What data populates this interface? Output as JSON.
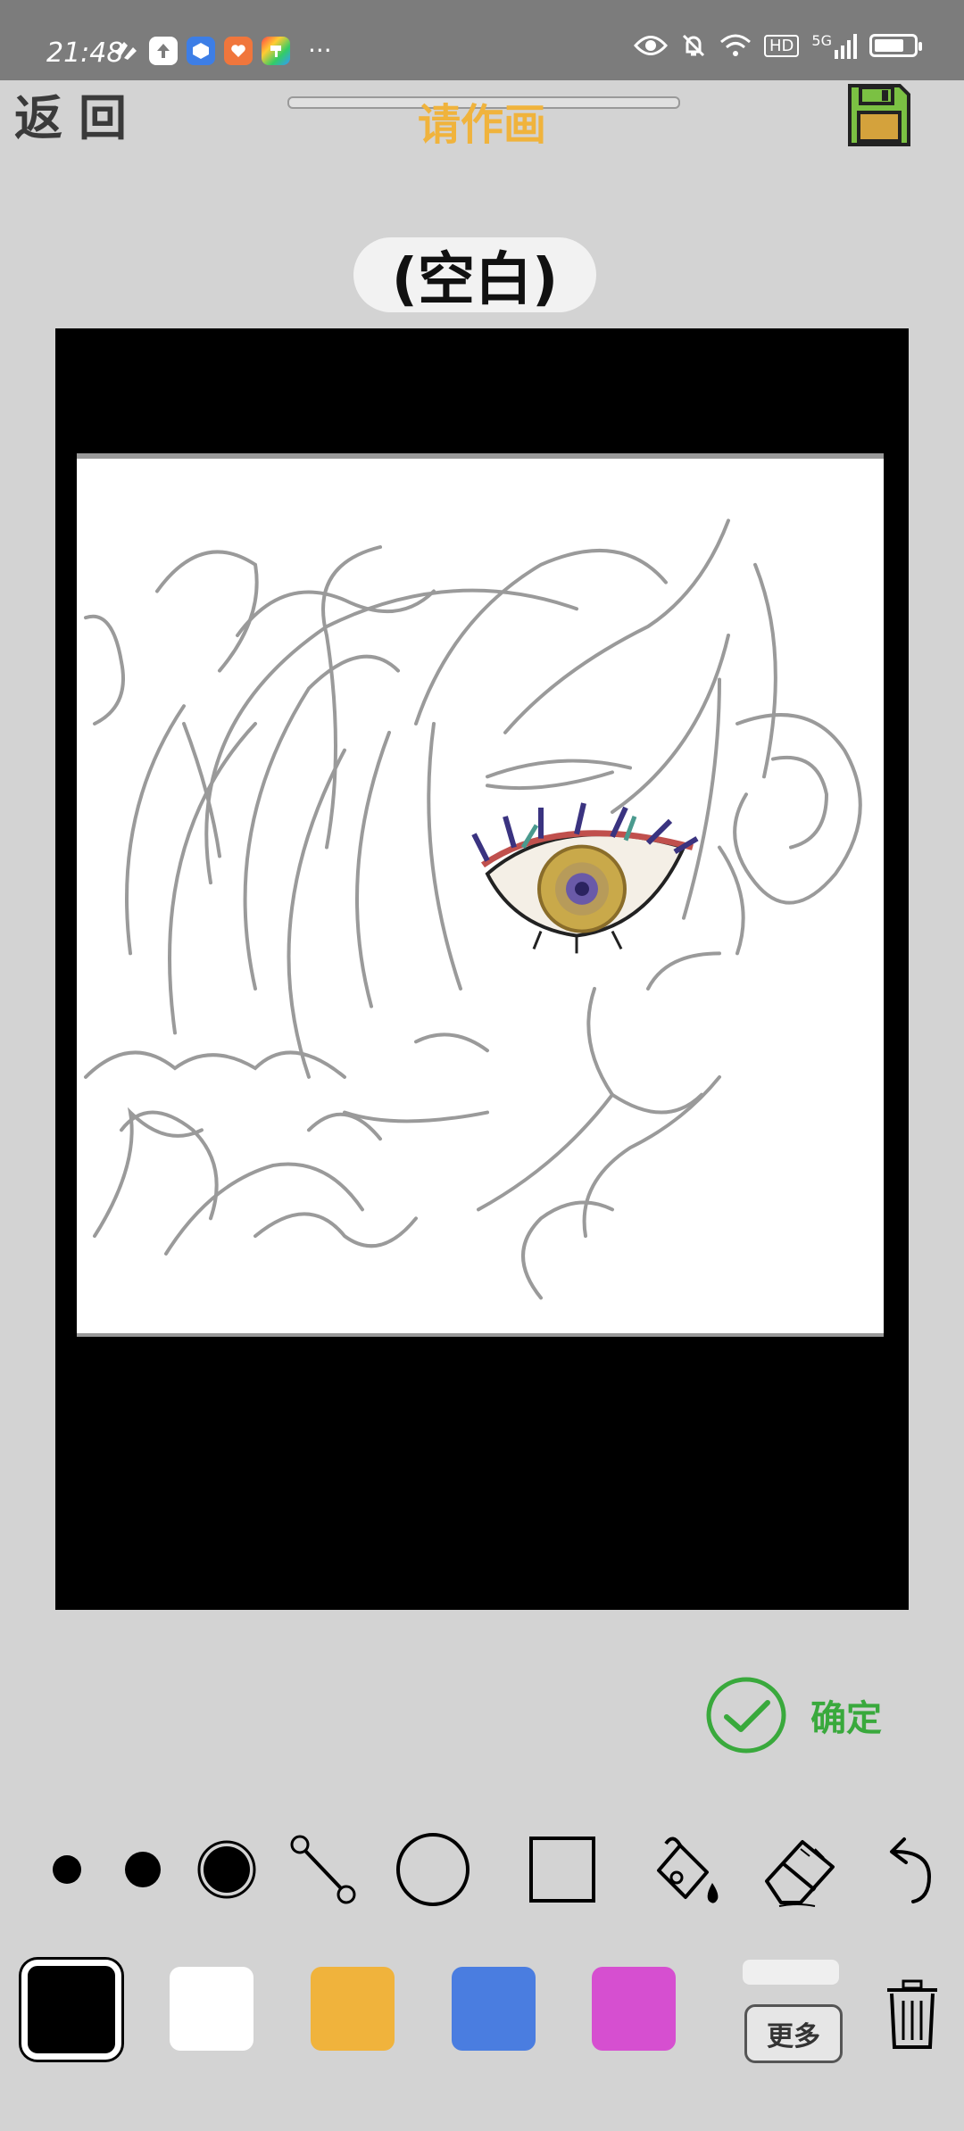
{
  "status_bar": {
    "time": "21:48",
    "more": "···",
    "hd": "HD",
    "network": "5G",
    "battery_level": 0.75,
    "app_icons": [
      "heart-app-icon",
      "upload-app-icon",
      "cube-app-icon",
      "mail-heart-app-icon",
      "paint-app-icon"
    ]
  },
  "header": {
    "back_label": "返回",
    "title": "请作画",
    "title_color": "#f0b33c"
  },
  "prompt": {
    "text": "(空白)"
  },
  "confirm": {
    "label": "确定",
    "color": "#39a93c"
  },
  "tools": [
    {
      "name": "brush-small"
    },
    {
      "name": "brush-medium"
    },
    {
      "name": "brush-large",
      "selected": true
    },
    {
      "name": "line"
    },
    {
      "name": "circle"
    },
    {
      "name": "rectangle"
    },
    {
      "name": "fill"
    },
    {
      "name": "eraser"
    },
    {
      "name": "undo"
    }
  ],
  "palette": {
    "colors": [
      "#000000",
      "#ffffff",
      "#f0b33c",
      "#4a7de0",
      "#d64fd0"
    ],
    "selected_index": 0,
    "more_label": "更多"
  }
}
